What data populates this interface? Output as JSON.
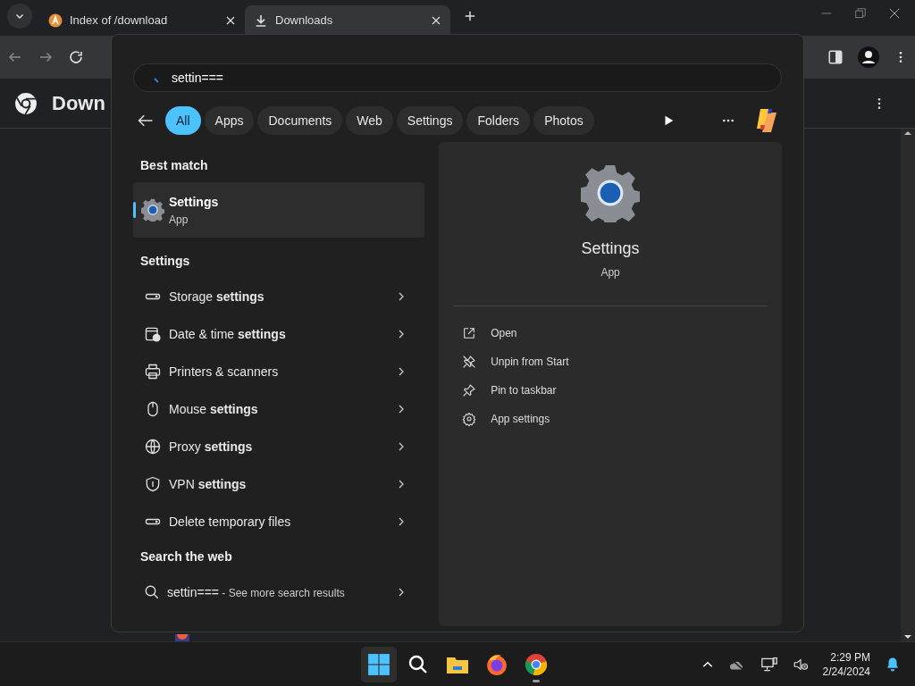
{
  "browser": {
    "tabs": [
      {
        "title": "Index of /download",
        "kind": "site",
        "selected": false
      },
      {
        "title": "Downloads",
        "kind": "download",
        "selected": true
      }
    ],
    "page_title": "Down"
  },
  "search": {
    "query": "settin===",
    "filters": [
      {
        "label": "All",
        "selected": true
      },
      {
        "label": "Apps",
        "selected": false
      },
      {
        "label": "Documents",
        "selected": false
      },
      {
        "label": "Web",
        "selected": false
      },
      {
        "label": "Settings",
        "selected": false
      },
      {
        "label": "Folders",
        "selected": false
      },
      {
        "label": "Photos",
        "selected": false
      }
    ],
    "best_match": {
      "heading": "Best match",
      "title": "Settings",
      "subtitle": "App",
      "selected": true
    },
    "settings_results": {
      "heading": "Settings",
      "items": [
        {
          "label": "Storage **settings**",
          "kind": "drive"
        },
        {
          "label": "Date & time **settings**",
          "kind": "clock"
        },
        {
          "label": "Printers & scanners",
          "kind": "printer"
        },
        {
          "label": "Mouse **settings**",
          "kind": "mouse"
        },
        {
          "label": "Proxy **settings**",
          "kind": "globe"
        },
        {
          "label": "VPN **settings**",
          "kind": "shield"
        },
        {
          "label": "Delete temporary files",
          "kind": "drive"
        }
      ]
    },
    "web": {
      "heading": "Search the web",
      "query": "settin===",
      "hint": " - See more search results"
    },
    "preview": {
      "title": "Settings",
      "subtitle": "App",
      "actions": [
        {
          "label": "Open",
          "kind": "open"
        },
        {
          "label": "Unpin from Start",
          "kind": "unpin"
        },
        {
          "label": "Pin to taskbar",
          "kind": "pin"
        },
        {
          "label": "App settings",
          "kind": "gear"
        }
      ]
    }
  },
  "taskbar": {
    "apps": [
      {
        "kind": "start",
        "selected": true,
        "running": false
      },
      {
        "kind": "search",
        "selected": false,
        "running": false
      },
      {
        "kind": "folder",
        "selected": false,
        "running": false
      },
      {
        "kind": "firefox",
        "selected": false,
        "running": false
      },
      {
        "kind": "chrome",
        "selected": false,
        "running": true
      }
    ],
    "time": "2:29 PM",
    "date": "2/24/2024"
  }
}
